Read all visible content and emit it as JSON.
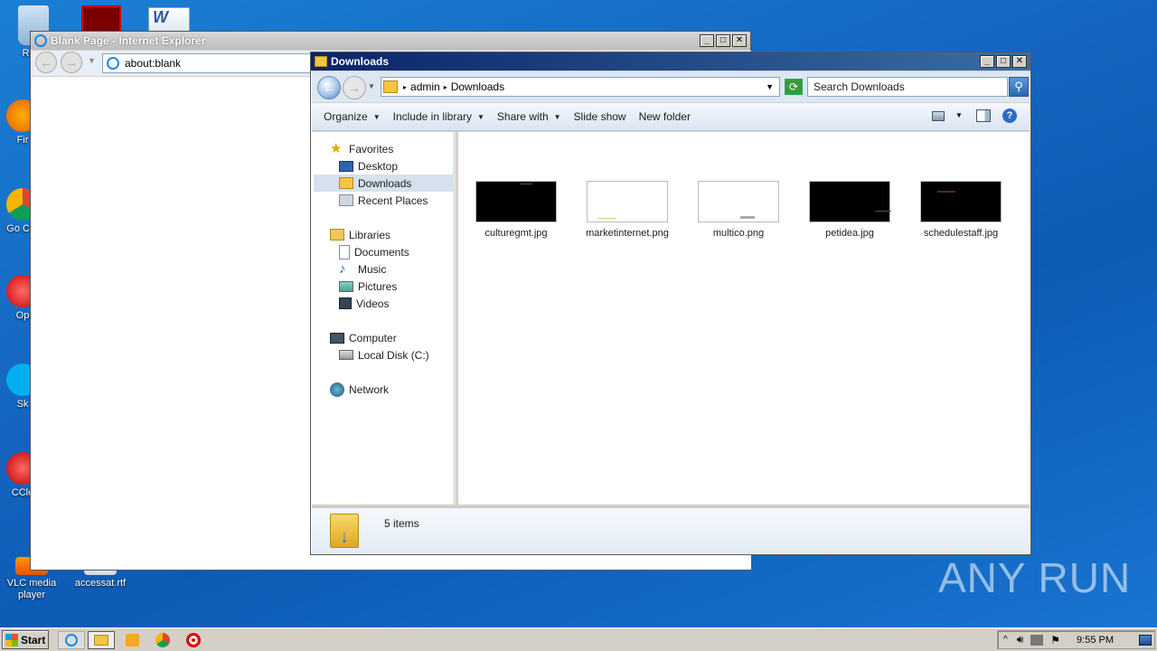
{
  "desktop": {
    "icons": [
      {
        "label": "Recy"
      },
      {
        "label": "Fir"
      },
      {
        "label": "Go Chr"
      },
      {
        "label": "Op"
      },
      {
        "label": "Sk"
      },
      {
        "label": "CCle"
      },
      {
        "label": "VLC media player"
      },
      {
        "label": "accessat.rtf"
      }
    ]
  },
  "ie": {
    "title": "Blank Page - Internet Explorer",
    "address": "about:blank"
  },
  "explorer": {
    "title": "Downloads",
    "breadcrumb": [
      "admin",
      "Downloads"
    ],
    "search_placeholder": "Search Downloads",
    "toolbar": {
      "organize": "Organize",
      "include": "Include in library",
      "share": "Share with",
      "slideshow": "Slide show",
      "newfolder": "New folder"
    },
    "nav": {
      "favorites": "Favorites",
      "desktop": "Desktop",
      "downloads": "Downloads",
      "recent": "Recent Places",
      "libraries": "Libraries",
      "documents": "Documents",
      "music": "Music",
      "pictures": "Pictures",
      "videos": "Videos",
      "computer": "Computer",
      "localdisk": "Local Disk (C:)",
      "network": "Network"
    },
    "files": [
      {
        "name": "culturegmt.jpg",
        "bg": "#000000"
      },
      {
        "name": "marketinternet.png",
        "bg": "#ffffff"
      },
      {
        "name": "multico.png",
        "bg": "#ffffff"
      },
      {
        "name": "petidea.jpg",
        "bg": "#000000"
      },
      {
        "name": "schedulestaff.jpg",
        "bg": "#000000"
      }
    ],
    "status": "5 items"
  },
  "taskbar": {
    "start": "Start",
    "time": "9:55 PM"
  },
  "watermark": "ANY RUN"
}
